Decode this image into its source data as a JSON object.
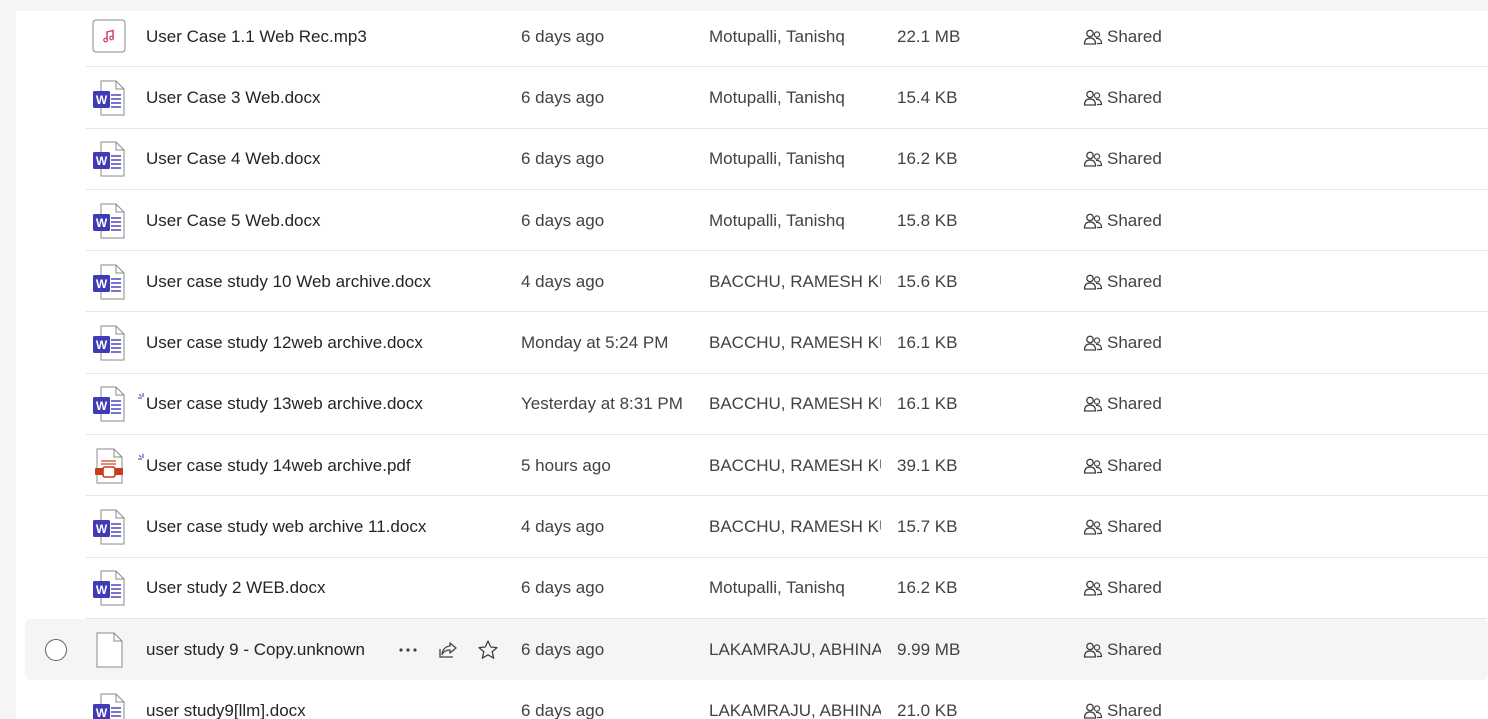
{
  "files": [
    {
      "name": "User Case 1.1 Web Rec.mp3",
      "type": "audio",
      "modified": "6 days ago",
      "modified_by": "Motupalli, Tanishq",
      "size": "22.1 MB",
      "sharing": "Shared",
      "is_new": false
    },
    {
      "name": "User Case 3 Web.docx",
      "type": "word",
      "modified": "6 days ago",
      "modified_by": "Motupalli, Tanishq",
      "size": "15.4 KB",
      "sharing": "Shared",
      "is_new": false
    },
    {
      "name": "User Case 4 Web.docx",
      "type": "word",
      "modified": "6 days ago",
      "modified_by": "Motupalli, Tanishq",
      "size": "16.2 KB",
      "sharing": "Shared",
      "is_new": false
    },
    {
      "name": "User Case 5 Web.docx",
      "type": "word",
      "modified": "6 days ago",
      "modified_by": "Motupalli, Tanishq",
      "size": "15.8 KB",
      "sharing": "Shared",
      "is_new": false
    },
    {
      "name": "User case study 10 Web archive.docx",
      "type": "word",
      "modified": "4 days ago",
      "modified_by": "BACCHU, RAMESH KUMAR",
      "size": "15.6 KB",
      "sharing": "Shared",
      "is_new": false
    },
    {
      "name": "User case study 12web archive.docx",
      "type": "word",
      "modified": "Monday at 5:24 PM",
      "modified_by": "BACCHU, RAMESH KUMAR",
      "size": "16.1 KB",
      "sharing": "Shared",
      "is_new": false
    },
    {
      "name": "User case study 13web archive.docx",
      "type": "word",
      "modified": "Yesterday at 8:31 PM",
      "modified_by": "BACCHU, RAMESH KUMAR",
      "size": "16.1 KB",
      "sharing": "Shared",
      "is_new": true
    },
    {
      "name": "User case study 14web archive.pdf",
      "type": "pdf",
      "modified": "5 hours ago",
      "modified_by": "BACCHU, RAMESH KUMAR",
      "size": "39.1 KB",
      "sharing": "Shared",
      "is_new": true
    },
    {
      "name": "User case study web archive 11.docx",
      "type": "word",
      "modified": "4 days ago",
      "modified_by": "BACCHU, RAMESH KUMAR",
      "size": "15.7 KB",
      "sharing": "Shared",
      "is_new": false
    },
    {
      "name": "User study 2 WEB.docx",
      "type": "word",
      "modified": "6 days ago",
      "modified_by": "Motupalli, Tanishq",
      "size": "16.2 KB",
      "sharing": "Shared",
      "is_new": false
    },
    {
      "name": "user study 9 - Copy.unknown",
      "type": "generic",
      "modified": "6 days ago",
      "modified_by": "LAKAMRAJU, ABHINAV",
      "size": "9.99 MB",
      "sharing": "Shared",
      "is_new": false,
      "hovered": true
    },
    {
      "name": "user study9[llm].docx",
      "type": "word",
      "modified": "6 days ago",
      "modified_by": "LAKAMRAJU, ABHINAV",
      "size": "21.0 KB",
      "sharing": "Shared",
      "is_new": false
    }
  ],
  "icons": {
    "audio": "audio-file-icon",
    "word": "word-file-icon",
    "pdf": "pdf-file-icon",
    "generic": "generic-file-icon",
    "shared": "people-icon",
    "more": "more-options-icon",
    "share": "share-icon",
    "favorite": "star-icon",
    "new": "new-item-icon"
  },
  "colors": {
    "word_blue": "#3f3bb6",
    "pdf_red": "#c43e1c",
    "audio_pink": "#d13478",
    "new_accent": "#5b5fc7",
    "text": "#242424",
    "subtext": "#424242",
    "divider": "#e6e6e6"
  }
}
